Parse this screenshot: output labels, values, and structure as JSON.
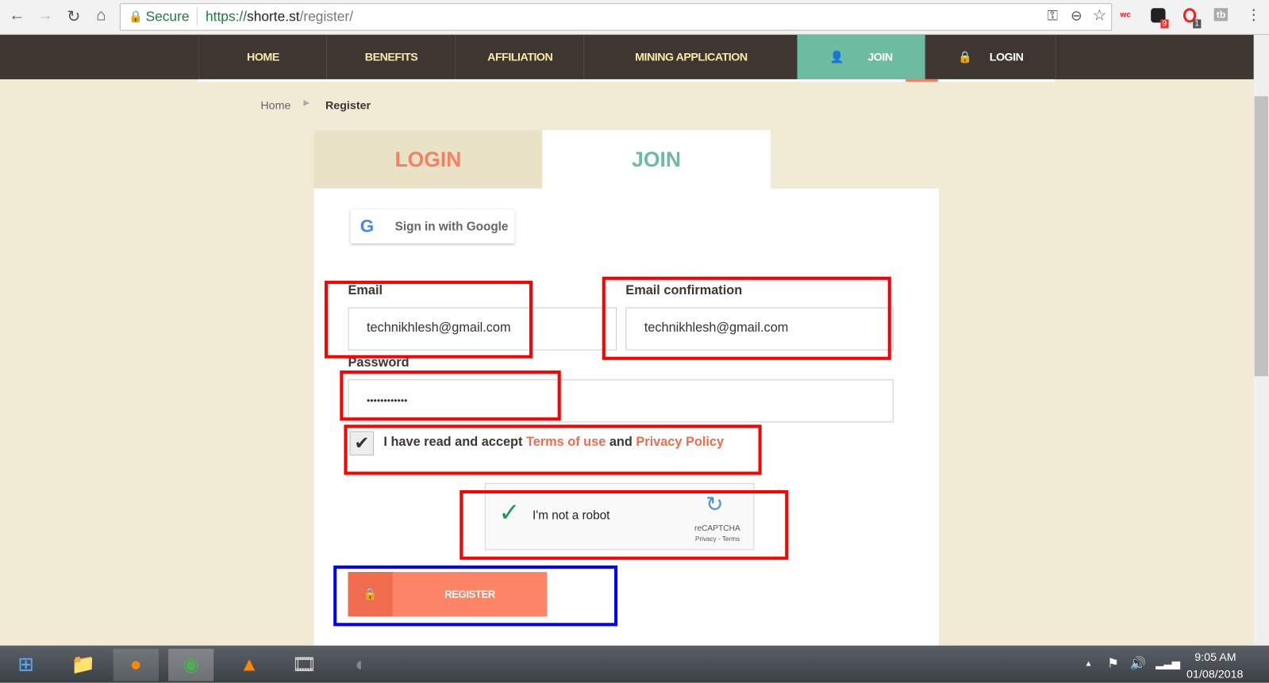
{
  "browser": {
    "secure_label": "Secure",
    "url_scheme": "https://",
    "url_host": "shorte.st",
    "url_path": "/register/",
    "ext_badges": [
      "9",
      "1"
    ],
    "ext_wc": "wc",
    "ext_tb": "tb"
  },
  "nav": {
    "items": [
      "HOME",
      "BENEFITS",
      "AFFILIATION",
      "MINING APPLICATION",
      "JOIN",
      "LOGIN"
    ]
  },
  "breadcrumb": {
    "home": "Home",
    "current": "Register"
  },
  "tabs": {
    "login": "LOGIN",
    "join": "JOIN"
  },
  "form": {
    "google_label": "Sign in with Google",
    "email_label": "Email",
    "email_value": "technikhlesh@gmail.com",
    "email_conf_label": "Email confirmation",
    "email_conf_value": "technikhlesh@gmail.com",
    "password_label": "Password",
    "password_value": "••••••••••••",
    "accept_prefix": "I have read and accept ",
    "terms": "Terms of use",
    "and": " and ",
    "privacy": "Privacy Policy",
    "accept_checked": true,
    "captcha_label": "I'm not a robot",
    "captcha_brand": "reCAPTCHA",
    "captcha_links": "Privacy - Terms",
    "register": "REGISTER"
  },
  "colors": {
    "nav_bg": "#3e3631",
    "join_accent": "#6dbba0",
    "login_accent": "#f48165",
    "register": "#fd8467",
    "annot_red": "#ff0000",
    "annot_blue": "#0000ff"
  },
  "taskbar": {
    "time": "9:05 AM",
    "date": "01/08/2018"
  }
}
